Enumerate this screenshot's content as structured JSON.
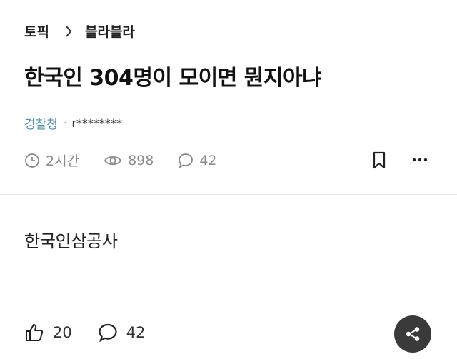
{
  "breadcrumb": {
    "parent": "토픽",
    "current": "블라블라"
  },
  "post": {
    "title": "한국인 304명이 모이면 뭔지아냐",
    "author_org": "경찰청",
    "author_sep": "·",
    "author_id": "r********",
    "time_ago": "2시간",
    "views": "898",
    "comments": "42",
    "body": "한국인삼공사"
  },
  "actions": {
    "likes": "20",
    "comments": "42"
  },
  "colors": {
    "org_link": "#4a8fb0",
    "meta_gray": "#8a8a8a",
    "share_bg": "#3a3a3a"
  },
  "icons": [
    "chevron-right-icon",
    "clock-icon",
    "eye-icon",
    "comment-icon",
    "bookmark-icon",
    "more-icon",
    "thumbs-up-icon",
    "share-icon"
  ]
}
